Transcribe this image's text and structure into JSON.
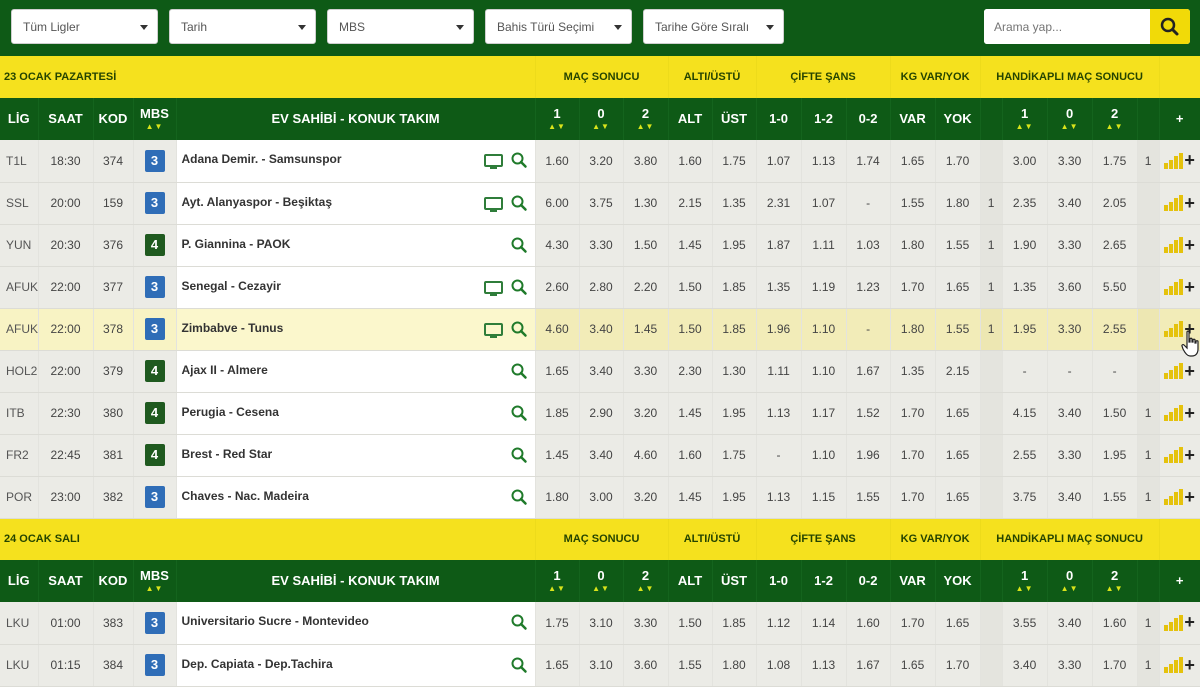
{
  "filters": [
    {
      "label": "Tüm Ligler"
    },
    {
      "label": "Tarih"
    },
    {
      "label": "MBS"
    },
    {
      "label": "Bahis Türü Seçimi"
    },
    {
      "label": "Tarihe Göre Sıralı"
    }
  ],
  "search": {
    "placeholder": "Arama yap..."
  },
  "sections": [
    {
      "day": "23 OCAK PAZARTESİ",
      "groups": [
        "MAÇ SONUCU",
        "ALTI/ÜSTÜ",
        "ÇİFTE ŞANS",
        "KG VAR/YOK",
        "HANDİKAPLI MAÇ SONUCU"
      ],
      "headers": [
        "LİG",
        "SAAT",
        "KOD",
        "MBS",
        "EV SAHİBİ - KONUK TAKIM",
        "1",
        "0",
        "2",
        "ALT",
        "ÜST",
        "1-0",
        "1-2",
        "0-2",
        "VAR",
        "YOK",
        "1",
        "0",
        "2",
        "+"
      ],
      "rows": [
        {
          "lig": "T1L",
          "saat": "18:30",
          "kod": "374",
          "mbs": "3",
          "match": "Adana Demir. - Samsunspor",
          "tv": true,
          "o1": "1.60",
          "o0": "3.20",
          "o2": "3.80",
          "alt": "1.60",
          "ust": "1.75",
          "c10": "1.07",
          "c12": "1.13",
          "c02": "1.74",
          "var": "1.65",
          "yok": "1.70",
          "hpre": "",
          "h1": "3.00",
          "h0": "3.30",
          "h2": "1.75",
          "hpost": "1"
        },
        {
          "lig": "SSL",
          "saat": "20:00",
          "kod": "159",
          "mbs": "3",
          "match": "Ayt. Alanyaspor - Beşiktaş",
          "tv": true,
          "o1": "6.00",
          "o0": "3.75",
          "o2": "1.30",
          "alt": "2.15",
          "ust": "1.35",
          "c10": "2.31",
          "c12": "1.07",
          "c02": "-",
          "var": "1.55",
          "yok": "1.80",
          "hpre": "1",
          "h1": "2.35",
          "h0": "3.40",
          "h2": "2.05",
          "hpost": ""
        },
        {
          "lig": "YUN",
          "saat": "20:30",
          "kod": "376",
          "mbs": "4",
          "match": "P. Giannina - PAOK",
          "tv": false,
          "o1": "4.30",
          "o0": "3.30",
          "o2": "1.50",
          "alt": "1.45",
          "ust": "1.95",
          "c10": "1.87",
          "c12": "1.11",
          "c02": "1.03",
          "var": "1.80",
          "yok": "1.55",
          "hpre": "1",
          "h1": "1.90",
          "h0": "3.30",
          "h2": "2.65",
          "hpost": ""
        },
        {
          "lig": "AFUK",
          "saat": "22:00",
          "kod": "377",
          "mbs": "3",
          "match": "Senegal - Cezayir",
          "tv": true,
          "o1": "2.60",
          "o0": "2.80",
          "o2": "2.20",
          "alt": "1.50",
          "ust": "1.85",
          "c10": "1.35",
          "c12": "1.19",
          "c02": "1.23",
          "var": "1.70",
          "yok": "1.65",
          "hpre": "1",
          "h1": "1.35",
          "h0": "3.60",
          "h2": "5.50",
          "hpost": ""
        },
        {
          "lig": "AFUK",
          "saat": "22:00",
          "kod": "378",
          "mbs": "3",
          "match": "Zimbabve - Tunus",
          "tv": true,
          "o1": "4.60",
          "o0": "3.40",
          "o2": "1.45",
          "alt": "1.50",
          "ust": "1.85",
          "c10": "1.96",
          "c12": "1.10",
          "c02": "-",
          "var": "1.80",
          "yok": "1.55",
          "hpre": "1",
          "h1": "1.95",
          "h0": "3.30",
          "h2": "2.55",
          "hpost": "",
          "highlight": true
        },
        {
          "lig": "HOL2",
          "saat": "22:00",
          "kod": "379",
          "mbs": "4",
          "match": "Ajax II - Almere",
          "tv": false,
          "o1": "1.65",
          "o0": "3.40",
          "o2": "3.30",
          "alt": "2.30",
          "ust": "1.30",
          "c10": "1.11",
          "c12": "1.10",
          "c02": "1.67",
          "var": "1.35",
          "yok": "2.15",
          "hpre": "",
          "h1": "-",
          "h0": "-",
          "h2": "-",
          "hpost": ""
        },
        {
          "lig": "ITB",
          "saat": "22:30",
          "kod": "380",
          "mbs": "4",
          "match": "Perugia - Cesena",
          "tv": false,
          "o1": "1.85",
          "o0": "2.90",
          "o2": "3.20",
          "alt": "1.45",
          "ust": "1.95",
          "c10": "1.13",
          "c12": "1.17",
          "c02": "1.52",
          "var": "1.70",
          "yok": "1.65",
          "hpre": "",
          "h1": "4.15",
          "h0": "3.40",
          "h2": "1.50",
          "hpost": "1"
        },
        {
          "lig": "FR2",
          "saat": "22:45",
          "kod": "381",
          "mbs": "4",
          "match": "Brest - Red Star",
          "tv": false,
          "o1": "1.45",
          "o0": "3.40",
          "o2": "4.60",
          "alt": "1.60",
          "ust": "1.75",
          "c10": "-",
          "c12": "1.10",
          "c02": "1.96",
          "var": "1.70",
          "yok": "1.65",
          "hpre": "",
          "h1": "2.55",
          "h0": "3.30",
          "h2": "1.95",
          "hpost": "1"
        },
        {
          "lig": "POR",
          "saat": "23:00",
          "kod": "382",
          "mbs": "3",
          "match": "Chaves - Nac. Madeira",
          "tv": false,
          "o1": "1.80",
          "o0": "3.00",
          "o2": "3.20",
          "alt": "1.45",
          "ust": "1.95",
          "c10": "1.13",
          "c12": "1.15",
          "c02": "1.55",
          "var": "1.70",
          "yok": "1.65",
          "hpre": "",
          "h1": "3.75",
          "h0": "3.40",
          "h2": "1.55",
          "hpost": "1"
        }
      ]
    },
    {
      "day": "24 OCAK SALI",
      "groups": [
        "MAÇ SONUCU",
        "ALTI/ÜSTÜ",
        "ÇİFTE ŞANS",
        "KG VAR/YOK",
        "HANDİKAPLI MAÇ SONUCU"
      ],
      "headers": [
        "LİG",
        "SAAT",
        "KOD",
        "MBS",
        "EV SAHİBİ - KONUK TAKIM",
        "1",
        "0",
        "2",
        "ALT",
        "ÜST",
        "1-0",
        "1-2",
        "0-2",
        "VAR",
        "YOK",
        "1",
        "0",
        "2",
        "+"
      ],
      "rows": [
        {
          "lig": "LKU",
          "saat": "01:00",
          "kod": "383",
          "mbs": "3",
          "match": "Universitario Sucre - Montevideo",
          "tv": false,
          "o1": "1.75",
          "o0": "3.10",
          "o2": "3.30",
          "alt": "1.50",
          "ust": "1.85",
          "c10": "1.12",
          "c12": "1.14",
          "c02": "1.60",
          "var": "1.70",
          "yok": "1.65",
          "hpre": "",
          "h1": "3.55",
          "h0": "3.40",
          "h2": "1.60",
          "hpost": "1"
        },
        {
          "lig": "LKU",
          "saat": "01:15",
          "kod": "384",
          "mbs": "3",
          "match": "Dep. Capiata - Dep.Tachira",
          "tv": false,
          "o1": "1.65",
          "o0": "3.10",
          "o2": "3.60",
          "alt": "1.55",
          "ust": "1.80",
          "c10": "1.08",
          "c12": "1.13",
          "c02": "1.67",
          "var": "1.65",
          "yok": "1.70",
          "hpre": "",
          "h1": "3.40",
          "h0": "3.30",
          "h2": "1.70",
          "hpost": "1"
        }
      ]
    }
  ]
}
